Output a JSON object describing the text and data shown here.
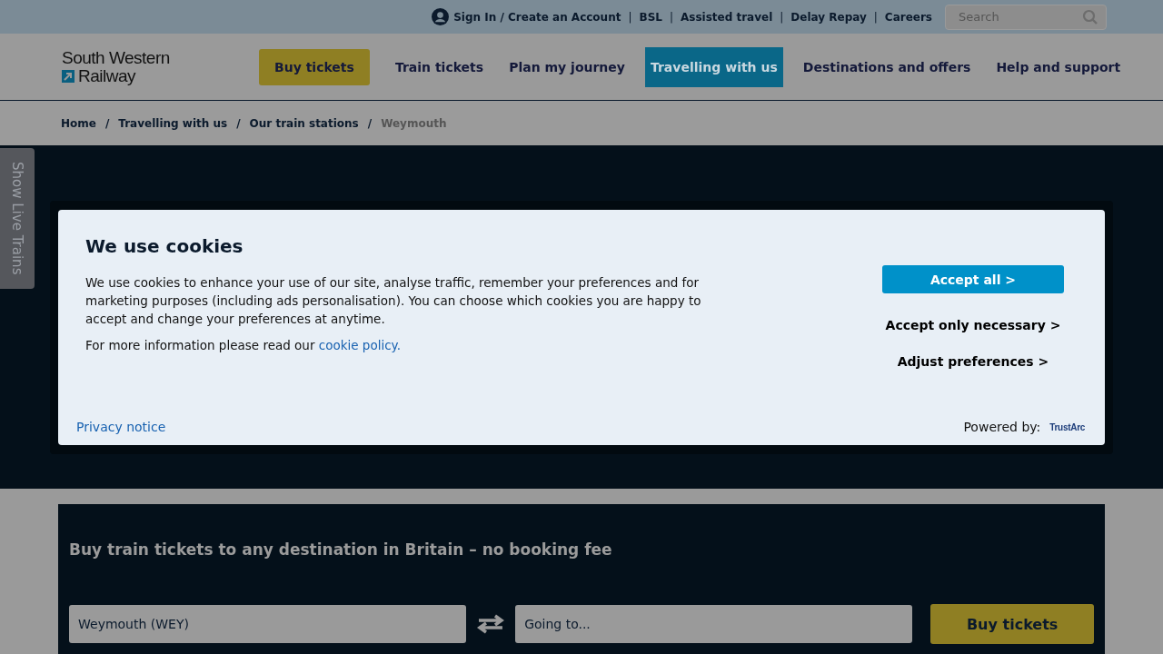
{
  "top_bar": {
    "account_link": "Sign In / Create an Account",
    "links": [
      "BSL",
      "Assisted travel",
      "Delay Repay",
      "Careers"
    ],
    "link_separator": "|",
    "search": {
      "placeholder": "Search"
    }
  },
  "header": {
    "logo": {
      "line_1": "South Western",
      "line_2": "Railway"
    },
    "nav": [
      {
        "label": "Buy tickets",
        "kind": "cta",
        "selected": false
      },
      {
        "label": "Train tickets",
        "kind": "link",
        "selected": false
      },
      {
        "label": "Plan my journey",
        "kind": "link",
        "selected": false
      },
      {
        "label": "Travelling with us",
        "kind": "link",
        "selected": true
      },
      {
        "label": "Destinations and offers",
        "kind": "link",
        "selected": false
      },
      {
        "label": "Help and support",
        "kind": "link",
        "selected": false
      }
    ]
  },
  "breadcrumb": [
    {
      "label": "Home",
      "current": false
    },
    {
      "label": "Travelling with us",
      "current": false
    },
    {
      "label": "Our train stations",
      "current": false
    },
    {
      "label": "Weymouth",
      "current": true
    }
  ],
  "breadcrumb_separator": "/",
  "live_trains_tab": "Show Live Trains",
  "cookie_dialog": {
    "title": "We use cookies",
    "body": "We use cookies to enhance your use of our site, analyse traffic, remember your preferences and for marketing purposes (including ads personalisation). You can choose which cookies you are happy to accept and change your preferences at anytime.",
    "more_info": "For more information please read our ",
    "policy_link": "cookie policy.",
    "buttons": [
      {
        "label": "Accept all >",
        "kind": "primary"
      },
      {
        "label": "Accept only necessary >",
        "kind": "text"
      },
      {
        "label": "Adjust preferences >",
        "kind": "text"
      }
    ],
    "privacy_link": "Privacy notice",
    "powered_by": "Powered by:",
    "provider_logo": "TrustArc"
  },
  "booking": {
    "heading": "Buy train tickets to any destination in Britain – no booking fee",
    "from": {
      "value": "Weymouth (WEY)"
    },
    "to": {
      "placeholder": "Going to..."
    },
    "button": "Buy tickets"
  }
}
